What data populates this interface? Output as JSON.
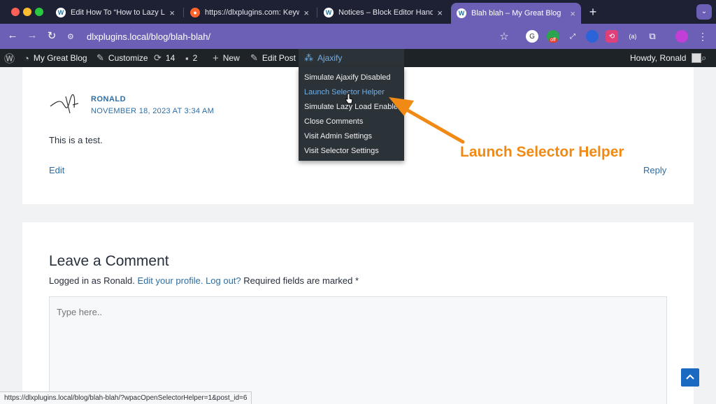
{
  "browser": {
    "tabs": [
      {
        "title": "Edit How To “How to Lazy Lo",
        "favicon": "wp-icon"
      },
      {
        "title": "https://dlxplugins.com: Keyw",
        "favicon": "semrush-icon"
      },
      {
        "title": "Notices – Block Editor Handb",
        "favicon": "wp-icon"
      },
      {
        "title": "Blah blah – My Great Blog",
        "favicon": "wp-icon"
      }
    ],
    "url": "dlxplugins.local/blog/blah-blah/",
    "extension_badge": "off"
  },
  "adminbar": {
    "site_name": "My Great Blog",
    "customize": "Customize",
    "updates_count": "14",
    "comments_count": "2",
    "new_label": "New",
    "edit_post": "Edit Post",
    "ajaxify": "Ajaxify",
    "howdy": "Howdy, Ronald"
  },
  "dropdown": {
    "items": [
      "Simulate Ajaxify Disabled",
      "Launch Selector Helper",
      "Simulate Lazy Load Enabled",
      "Close Comments",
      "Visit Admin Settings",
      "Visit Selector Settings"
    ],
    "hovered_index": 1
  },
  "comment": {
    "author": "RONALD",
    "date": "NOVEMBER 18, 2023 AT 3:34 AM",
    "text": "This is a test.",
    "edit": "Edit",
    "reply": "Reply"
  },
  "respond": {
    "title": "Leave a Comment",
    "logged_in_prefix": "Logged in as Ronald.",
    "edit_profile": "Edit your profile.",
    "logout": "Log out?",
    "required": "Required fields are marked *",
    "placeholder": "Type here.."
  },
  "annotation": "Launch Selector Helper",
  "status_url": "https://dlxplugins.local/blog/blah-blah/?wpacOpenSelectorHelper=1&post_id=6",
  "colors": {
    "accent": "#6b60b5",
    "link": "#2d6da3",
    "annotation": "#f08a15",
    "admin_bar": "#1d2327"
  }
}
